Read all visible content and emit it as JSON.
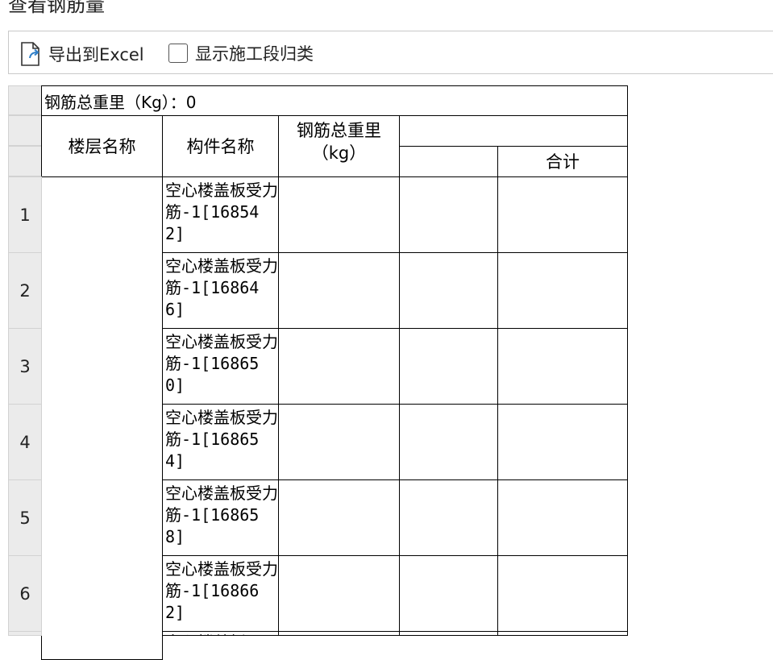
{
  "page": {
    "title": "查看钢筋量"
  },
  "toolbar": {
    "export_label": "导出到Excel",
    "show_stage_label": "显示施工段归类",
    "show_stage_checked": false
  },
  "table": {
    "total_label": "钢筋总重里（Kg）：0",
    "headers": {
      "floor_name": "楼层名称",
      "component_name": "构件名称",
      "total_weight": "钢筋总重里",
      "total_weight_unit": "（kg）",
      "group": "",
      "sub_blank": "",
      "subtotal": "合计"
    },
    "rows": [
      {
        "index": "1",
        "floor": "",
        "component": "空心楼盖板受力筋-1[168542]",
        "weight": "",
        "c4": "",
        "sum": ""
      },
      {
        "index": "2",
        "floor": "",
        "component": "空心楼盖板受力筋-1[168646]",
        "weight": "",
        "c4": "",
        "sum": ""
      },
      {
        "index": "3",
        "floor": "",
        "component": "空心楼盖板受力筋-1[168650]",
        "weight": "",
        "c4": "",
        "sum": ""
      },
      {
        "index": "4",
        "floor": "",
        "component": "空心楼盖板受力筋-1[168654]",
        "weight": "",
        "c4": "",
        "sum": ""
      },
      {
        "index": "5",
        "floor": "",
        "component": "空心楼盖板受力筋-1[168658]",
        "weight": "",
        "c4": "",
        "sum": ""
      },
      {
        "index": "6",
        "floor": "",
        "component": "空心楼盖板受力筋-1[168662]",
        "weight": "",
        "c4": "",
        "sum": ""
      },
      {
        "index": "",
        "floor": "",
        "component": "空心楼盖板",
        "weight": "",
        "c4": "",
        "sum": ""
      }
    ]
  },
  "colors": {
    "grid_line": "#000000",
    "row_header_bg": "#ebebeb",
    "toolbar_border": "#c9c9c9",
    "icon_accent": "#2f7fc8"
  }
}
